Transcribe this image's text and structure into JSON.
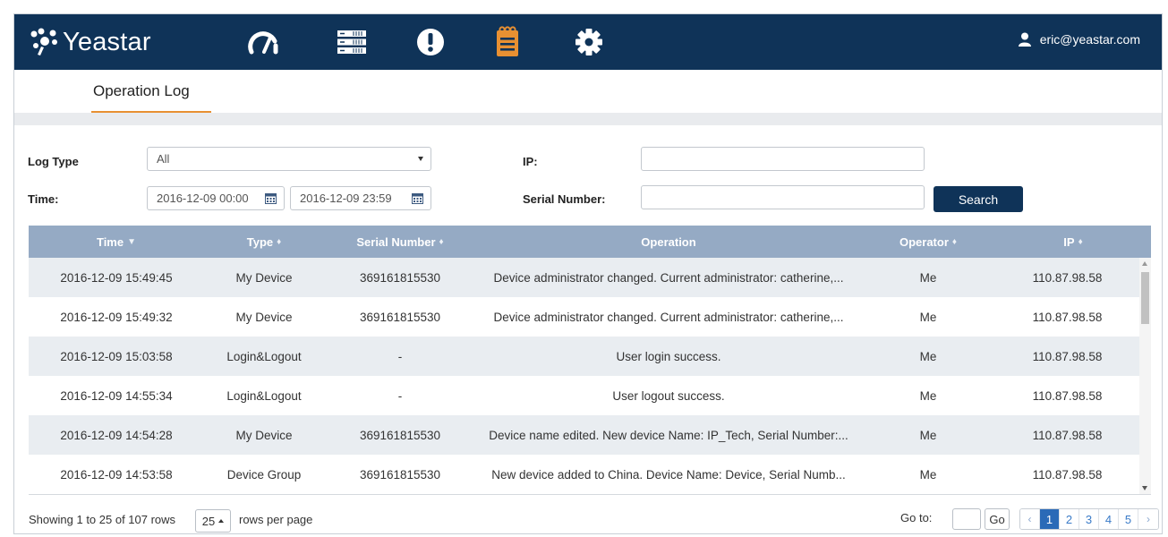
{
  "header": {
    "logo_text": "Yeastar",
    "nav_icons": [
      "dashboard-gauge-icon",
      "server-list-icon",
      "alert-icon",
      "operation-log-icon",
      "settings-gear-icon"
    ],
    "active_icon": "operation-log-icon",
    "user_email": "eric@yeastar.com",
    "colors": {
      "nav_bg": "#0f3358",
      "active_icon": "#e89032",
      "accent": "#e89032"
    }
  },
  "tabs": [
    {
      "label": "Operation Log",
      "active": true
    }
  ],
  "filters": {
    "log_type_label": "Log Type",
    "log_type_value": "All",
    "time_label": "Time:",
    "time_start": "2016-12-09 00:00",
    "time_end": "2016-12-09 23:59",
    "ip_label": "IP:",
    "ip_value": "",
    "serial_label": "Serial Number:",
    "serial_value": "",
    "search_button": "Search"
  },
  "table": {
    "columns": [
      {
        "label": "Time",
        "sort": "▼"
      },
      {
        "label": "Type",
        "sort": "♦"
      },
      {
        "label": "Serial Number",
        "sort": "♦"
      },
      {
        "label": "Operation",
        "sort": ""
      },
      {
        "label": "Operator",
        "sort": "♦"
      },
      {
        "label": "IP",
        "sort": "♦"
      }
    ],
    "rows": [
      [
        "2016-12-09 15:49:45",
        "My Device",
        "369161815530",
        "Device administrator changed. Current administrator: catherine,...",
        "Me",
        "110.87.98.58"
      ],
      [
        "2016-12-09 15:49:32",
        "My Device",
        "369161815530",
        "Device administrator changed. Current administrator: catherine,...",
        "Me",
        "110.87.98.58"
      ],
      [
        "2016-12-09 15:03:58",
        "Login&Logout",
        "-",
        "User login success.",
        "Me",
        "110.87.98.58"
      ],
      [
        "2016-12-09 14:55:34",
        "Login&Logout",
        "-",
        "User logout success.",
        "Me",
        "110.87.98.58"
      ],
      [
        "2016-12-09 14:54:28",
        "My Device",
        "369161815530",
        "Device name edited. New device Name: IP_Tech, Serial Number:...",
        "Me",
        "110.87.98.58"
      ],
      [
        "2016-12-09 14:53:58",
        "Device Group",
        "369161815530",
        "New device added to China. Device Name: Device, Serial Numb...",
        "Me",
        "110.87.98.58"
      ]
    ]
  },
  "footer": {
    "showing_text": "Showing 1 to 25 of 107 rows",
    "per_page_value": "25",
    "rows_per_page_text": "rows per page",
    "goto_label": "Go to:",
    "go_button": "Go",
    "prev": "‹",
    "pages": [
      "1",
      "2",
      "3",
      "4",
      "5"
    ],
    "current_page": "1",
    "next": "›"
  }
}
